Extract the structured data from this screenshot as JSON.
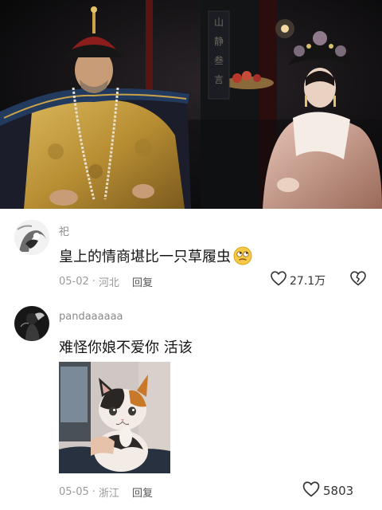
{
  "comments": [
    {
      "username": "祀",
      "text": "皇上的情商堪比一只草履虫",
      "emoji": "rolling-eyes-emoji",
      "date": "05-02",
      "location": "河北",
      "reply_label": "回复",
      "like_count": "27.1万",
      "has_dislike": true
    },
    {
      "username": "pandaaaaaa",
      "text": "难怪你娘不爱你 活该",
      "date": "05-05",
      "location": "浙江",
      "reply_label": "回复",
      "like_count": "5803"
    }
  ],
  "hero_sign_text": "山静叁言",
  "colors": {
    "meta_gray": "#9a9a9a",
    "username_gray": "#8a8a8a",
    "text_dark": "#151515"
  },
  "icons": [
    "heart-outline-icon",
    "broken-heart-icon",
    "rolling-eyes-emoji"
  ]
}
